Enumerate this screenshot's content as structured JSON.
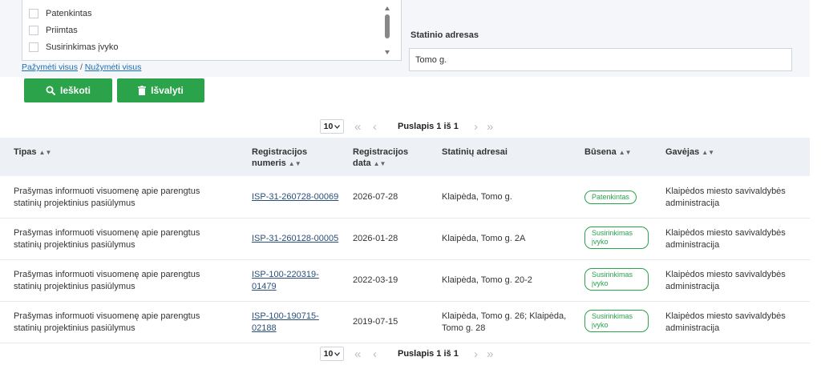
{
  "filters": {
    "status_options": [
      "Patenkintas",
      "Priimtas",
      "Susirinkimas įvyko"
    ],
    "select_all": "Pažymėti visus",
    "separator": "/",
    "deselect_all": "Nužymėti visus",
    "address_label": "Statinio adresas",
    "address_value": "Tomo g."
  },
  "actions": {
    "search_label": "Ieškoti",
    "clear_label": "Išvalyti",
    "button_color": "#2aa34a"
  },
  "pagination": {
    "page_size": "10",
    "page_text": "Puslapis 1 iš 1"
  },
  "table": {
    "columns": [
      "Tipas",
      "Registracijos numeris",
      "Registracijos data",
      "Statinių adresai",
      "Būsena",
      "Gavėjas"
    ],
    "rows": [
      {
        "type": "Prašymas informuoti visuomenę apie parengtus statinių projektinius pasiūlymus",
        "reg_number": "ISP-31-260728-00069",
        "reg_date": "2026-07-28",
        "addresses": "Klaipėda, Tomo g.",
        "status": "Patenkintas",
        "recipient": "Klaipėdos miesto savivaldybės administracija"
      },
      {
        "type": "Prašymas informuoti visuomenę apie parengtus statinių projektinius pasiūlymus",
        "reg_number": "ISP-31-260128-00005",
        "reg_date": "2026-01-28",
        "addresses": "Klaipėda, Tomo g. 2A",
        "status": "Susirinkimas įvyko",
        "recipient": "Klaipėdos miesto savivaldybės administracija"
      },
      {
        "type": "Prašymas informuoti visuomenę apie parengtus statinių projektinius pasiūlymus",
        "reg_number": "ISP-100-220319-01479",
        "reg_date": "2022-03-19",
        "addresses": "Klaipėda, Tomo g. 20-2",
        "status": "Susirinkimas įvyko",
        "recipient": "Klaipėdos miesto savivaldybės administracija"
      },
      {
        "type": "Prašymas informuoti visuomenę apie parengtus statinių projektinius pasiūlymus",
        "reg_number": "ISP-100-190715-02188",
        "reg_date": "2019-07-15",
        "addresses": "Klaipėda, Tomo g. 26; Klaipėda, Tomo g. 28",
        "status": "Susirinkimas įvyko",
        "recipient": "Klaipėdos miesto savivaldybės administracija"
      }
    ]
  }
}
